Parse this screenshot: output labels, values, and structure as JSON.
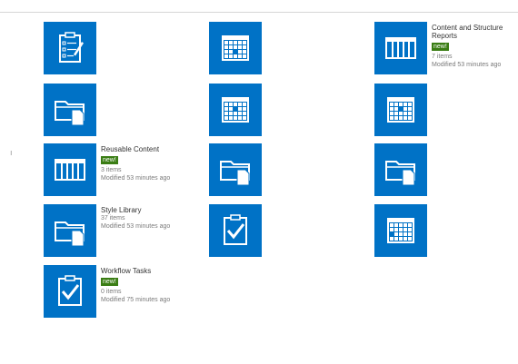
{
  "colors": {
    "tile": "#0072c6",
    "badge": "#3a7d14"
  },
  "tiles": [
    {
      "icon": "tasks-checklist-icon"
    },
    {
      "icon": "calendar-icon"
    },
    {
      "icon": "list-icon",
      "title": "Content and Structure Reports",
      "badge": "new!",
      "items": "7 items",
      "modified": "Modified 53 minutes ago"
    },
    {
      "icon": "folder-document-icon"
    },
    {
      "icon": "calendar-icon"
    },
    {
      "icon": "calendar-icon"
    },
    {
      "icon": "list-icon",
      "title": "Reusable Content",
      "badge": "new!",
      "items": "3 items",
      "modified": "Modified 53 minutes ago"
    },
    {
      "icon": "folder-document-icon"
    },
    {
      "icon": "folder-document-icon"
    },
    {
      "icon": "folder-document-icon",
      "title": "Style Library",
      "items": "37 items",
      "modified": "Modified 53 minutes ago"
    },
    {
      "icon": "task-clipboard-icon"
    },
    {
      "icon": "calendar-icon"
    },
    {
      "icon": "task-clipboard-icon",
      "title": "Workflow Tasks",
      "badge": "new!",
      "items": "0 items",
      "modified": "Modified 75 minutes ago"
    }
  ]
}
